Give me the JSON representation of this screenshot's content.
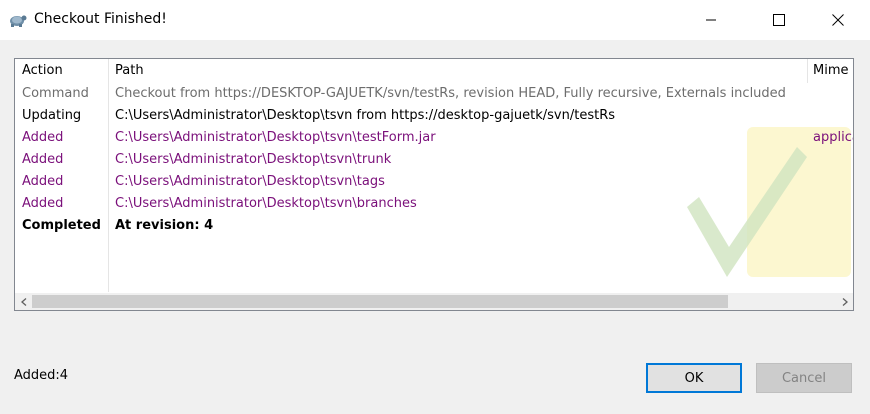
{
  "window": {
    "title": "Checkout Finished!"
  },
  "table": {
    "headers": [
      "Action",
      "Path",
      "Mime"
    ],
    "rows": [
      {
        "action": "Command",
        "path": "Checkout from https://DESKTOP-GAJUETK/svn/testRs, revision HEAD, Fully recursive, Externals included",
        "mime": ""
      },
      {
        "action": "Updating",
        "path": "C:\\Users\\Administrator\\Desktop\\tsvn from https://desktop-gajuetk/svn/testRs",
        "mime": ""
      },
      {
        "action": "Added",
        "path": "C:\\Users\\Administrator\\Desktop\\tsvn\\testForm.jar",
        "mime": "applica"
      },
      {
        "action": "Added",
        "path": "C:\\Users\\Administrator\\Desktop\\tsvn\\trunk",
        "mime": ""
      },
      {
        "action": "Added",
        "path": "C:\\Users\\Administrator\\Desktop\\tsvn\\tags",
        "mime": ""
      },
      {
        "action": "Added",
        "path": "C:\\Users\\Administrator\\Desktop\\tsvn\\branches",
        "mime": ""
      },
      {
        "action": "Completed",
        "path": "At revision: 4",
        "mime": ""
      }
    ]
  },
  "status": {
    "text": "Added:4"
  },
  "buttons": {
    "ok": "OK",
    "cancel": "Cancel"
  },
  "colors": {
    "added_row": "#7a0f7a",
    "command_row": "#6d6d6d",
    "focus_border": "#0078d7"
  }
}
